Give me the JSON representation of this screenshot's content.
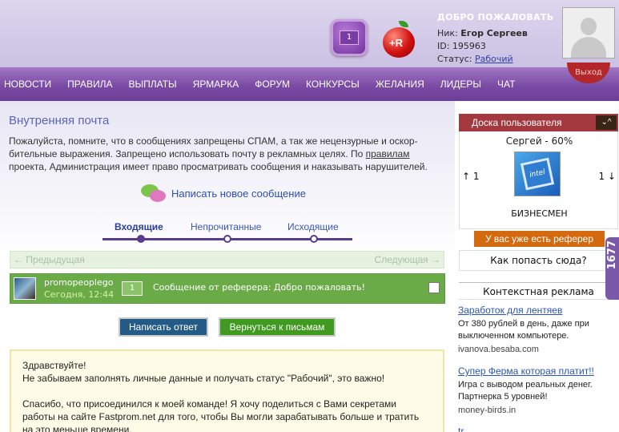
{
  "header": {
    "messages_count": "1",
    "apple_label": "+R",
    "welcome_title": "ДОБРО ПОЖАЛОВАТЬ",
    "nick_label": "Ник:",
    "nick_value": "Егор Сергеев",
    "id_label": "ID:",
    "id_value": "195963",
    "status_label": "Статус:",
    "status_value": "Рабочий",
    "logout_label": "Выход"
  },
  "nav": {
    "items": [
      "НОВОСТИ",
      "ПРАВИЛА",
      "ВЫПЛАТЫ",
      "ЯРМАРКА",
      "ФОРУМ",
      "КОНКУРСЫ",
      "ЖЕЛАНИЯ",
      "ЛИДЕРЫ",
      "ЧАТ"
    ]
  },
  "main": {
    "title": "Внутренняя почта",
    "notice_1": "Пожалуйста, помните, что в сообщениях запрещены СПАМ, а так же нецензурные и оскор-бительные выражения. Запрещено использовать почту в рекламных целях. По ",
    "notice_link": "правилам",
    "notice_2": " проекта, Администрация имеет право просматривать сообщения и наказывать нарушителей.",
    "compose_label": "Написать новое сообщение",
    "tabs": [
      "Входящие",
      "Непрочитанные",
      "Исходящие"
    ],
    "pager_prev": "← Предыдущая",
    "pager_next": "Следующая →",
    "message": {
      "sender": "promopeoplego",
      "date": "Сегодня, 12:44",
      "count": "1",
      "subject": "Сообщение от реферера: Добро пожаловать!"
    },
    "reply_button": "Написать ответ",
    "back_button": "Вернуться к письмам",
    "letter": {
      "line1": "Здравствуйте!",
      "line2": "Не забываем заполнять личные данные и получать статус \"Рабочий\", это важно!",
      "line3": "Спасибо, что присоединился к моей команде! Я хочу поделиться с Вами секретами работы на сайте Fastprom.net для того, чтобы Вы могли зарабатывать больше и тратить на это меньше времени."
    }
  },
  "sidebar": {
    "board_title": "Доска пользователя",
    "arrows": "⌄^",
    "user_line": "Сергей - 60%",
    "vote_up": "↑ 1",
    "vote_down": "1 ↓",
    "rank_chip": "intel",
    "rank_name": "БИЗНЕСМЕН",
    "referrer_button": "У вас уже есть реферер",
    "how_link": "Как попасть сюда?",
    "ads_title": "Контекстная реклама",
    "ads": [
      {
        "title": "Заработок для лентяев",
        "text": "От 380 рублей в день, даже при выключенном компьютере.",
        "url": "ivanova.besaba.com"
      },
      {
        "title": "Супер Ферма которая платит!!",
        "text": "Игра с выводом реальных денег. Партнерка 5 уровней!",
        "url": "money-birds.in"
      },
      {
        "title": "tr...",
        "text": "",
        "url": ""
      }
    ],
    "counter": "1677"
  }
}
